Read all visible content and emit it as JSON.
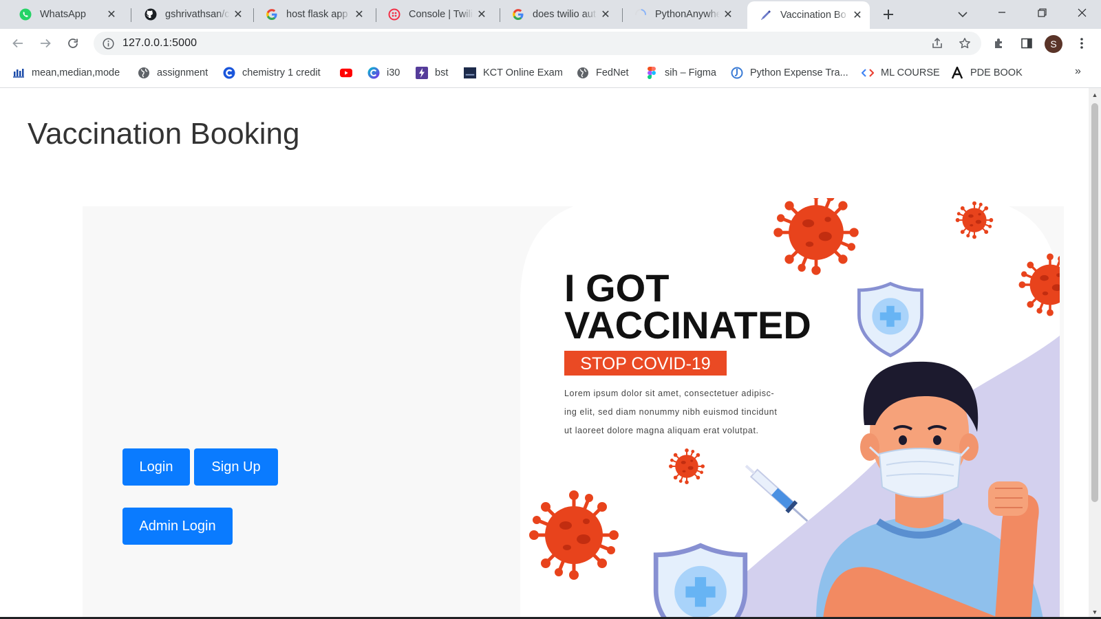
{
  "browser": {
    "tabs": [
      {
        "label": "WhatsApp",
        "icon": "whatsapp-icon",
        "active": false
      },
      {
        "label": "gshrivathsan/c",
        "icon": "github-icon",
        "active": false
      },
      {
        "label": "host flask app",
        "icon": "google-icon",
        "active": false
      },
      {
        "label": "Console | Twilio",
        "icon": "twilio-icon",
        "active": false
      },
      {
        "label": "does twilio aut",
        "icon": "google-icon",
        "active": false
      },
      {
        "label": "PythonAnywhe",
        "icon": "loading-icon",
        "active": false
      },
      {
        "label": "Vaccination Bo",
        "icon": "vaccination-icon",
        "active": true
      }
    ],
    "url": "127.0.0.1:5000",
    "profile_initial": "S",
    "bookmarks": [
      {
        "label": "mean,median,mode",
        "icon": "chart-bars-icon"
      },
      {
        "label": "assignment",
        "icon": "globe-icon"
      },
      {
        "label": "chemistry 1 credit",
        "icon": "c-logo-icon"
      },
      {
        "label": "",
        "icon": "youtube-icon"
      },
      {
        "label": "i30",
        "icon": "c-gradient-icon"
      },
      {
        "label": "bst",
        "icon": "lightning-icon"
      },
      {
        "label": "KCT Online Exam",
        "icon": "kct-icon"
      },
      {
        "label": "FedNet",
        "icon": "globe-icon"
      },
      {
        "label": "sih – Figma",
        "icon": "figma-icon"
      },
      {
        "label": "Python Expense Tra...",
        "icon": "python-icon"
      },
      {
        "label": "ML COURSE",
        "icon": "code-icon"
      },
      {
        "label": "PDE BOOK",
        "icon": "letter-a-icon"
      }
    ]
  },
  "page": {
    "title": "Vaccination Booking",
    "buttons": {
      "login": "Login",
      "signup": "Sign Up",
      "admin": "Admin Login"
    },
    "poster": {
      "headline_1": "I GOT",
      "headline_2": "VACCINATED",
      "badge": "STOP COVID-19",
      "body_1": "Lorem ipsum dolor sit amet, consectetuer adipisc-",
      "body_2": "ing elit, sed diam nonummy nibh euismod tincidunt",
      "body_3": "ut laoreet dolore magna aliquam erat volutpat."
    }
  },
  "colors": {
    "primary_button": "#0a7bff",
    "virus_red": "#e8431c",
    "badge_red": "#ea4a24",
    "blob_lavender": "#d3d0ee"
  }
}
